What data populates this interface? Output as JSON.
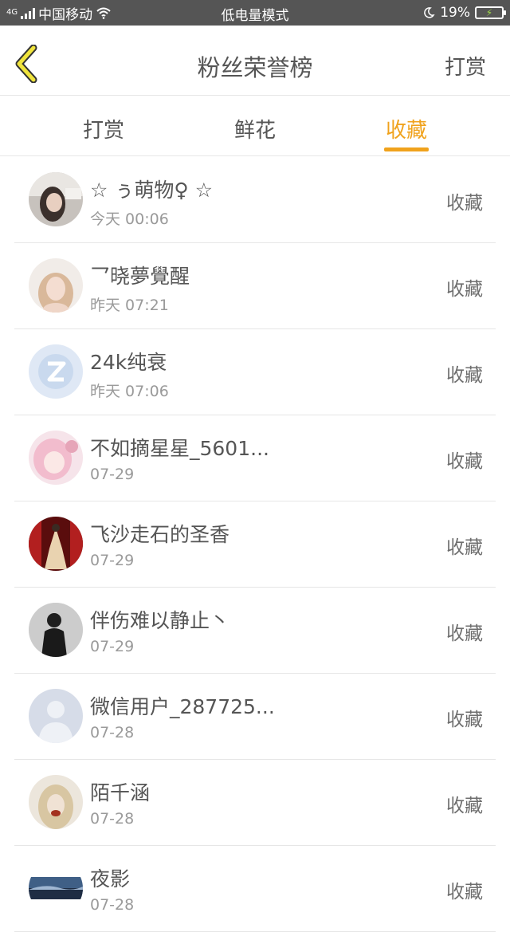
{
  "status_bar": {
    "network": "4G",
    "carrier": "中国移动",
    "mode": "低电量模式",
    "battery": "19%"
  },
  "header": {
    "back_icon": "chevron-left-icon",
    "title": "粉丝荣誉榜",
    "right_action": "打赏"
  },
  "tabs": [
    {
      "label": "打赏",
      "active": false
    },
    {
      "label": "鲜花",
      "active": false
    },
    {
      "label": "收藏",
      "active": true
    }
  ],
  "colors": {
    "accent": "#f0a21c",
    "text": "#555555",
    "secondary": "#9a9a9a"
  },
  "list": [
    {
      "name": "☆ ぅ萌物♀ ☆",
      "time": "今天 00:06",
      "action": "收藏"
    },
    {
      "name": "乛晓夢覺醒",
      "time": "昨天 07:21",
      "action": "收藏"
    },
    {
      "name": "24k纯衰",
      "time": "昨天 07:06",
      "action": "收藏"
    },
    {
      "name": "不如摘星星_5601...",
      "time": "07-29",
      "action": "收藏"
    },
    {
      "name": "飞沙走石的圣香",
      "time": "07-29",
      "action": "收藏"
    },
    {
      "name": "伴伤难以静止丶",
      "time": "07-29",
      "action": "收藏"
    },
    {
      "name": "微信用户_287725...",
      "time": "07-28",
      "action": "收藏"
    },
    {
      "name": "陌千涵",
      "time": "07-28",
      "action": "收藏"
    },
    {
      "name": "夜影",
      "time": "07-28",
      "action": "收藏"
    }
  ]
}
